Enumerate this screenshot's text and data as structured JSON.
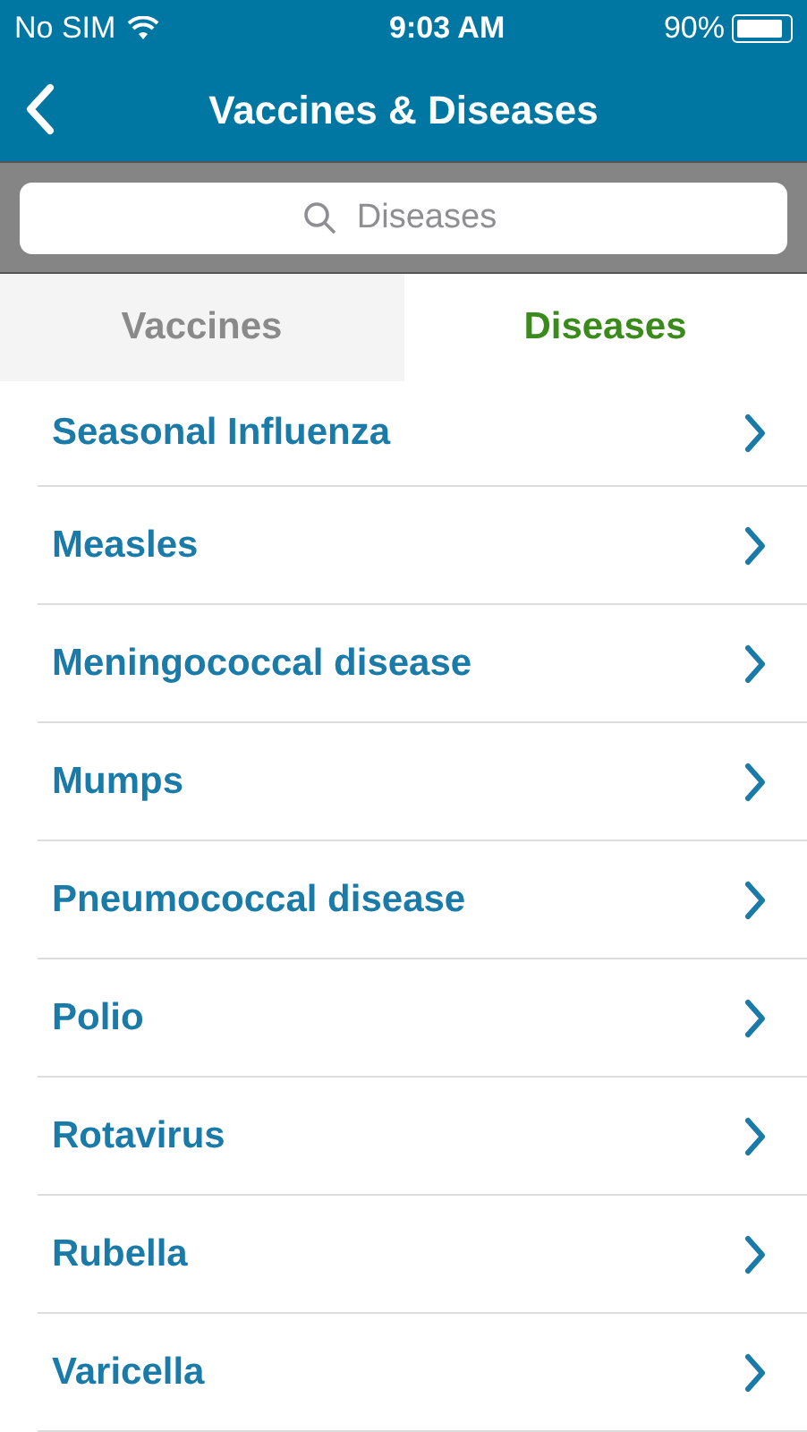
{
  "status_bar": {
    "carrier": "No SIM",
    "time": "9:03 AM",
    "battery": "90%"
  },
  "nav": {
    "title": "Vaccines & Diseases"
  },
  "search": {
    "placeholder": "Diseases"
  },
  "tabs": [
    {
      "label": "Vaccines",
      "selected": false
    },
    {
      "label": "Diseases",
      "selected": true
    }
  ],
  "items": [
    {
      "label": "Seasonal Influenza"
    },
    {
      "label": "Measles"
    },
    {
      "label": "Meningococcal disease"
    },
    {
      "label": "Mumps"
    },
    {
      "label": "Pneumococcal disease"
    },
    {
      "label": "Polio"
    },
    {
      "label": "Rotavirus"
    },
    {
      "label": "Rubella"
    },
    {
      "label": "Varicella"
    }
  ]
}
